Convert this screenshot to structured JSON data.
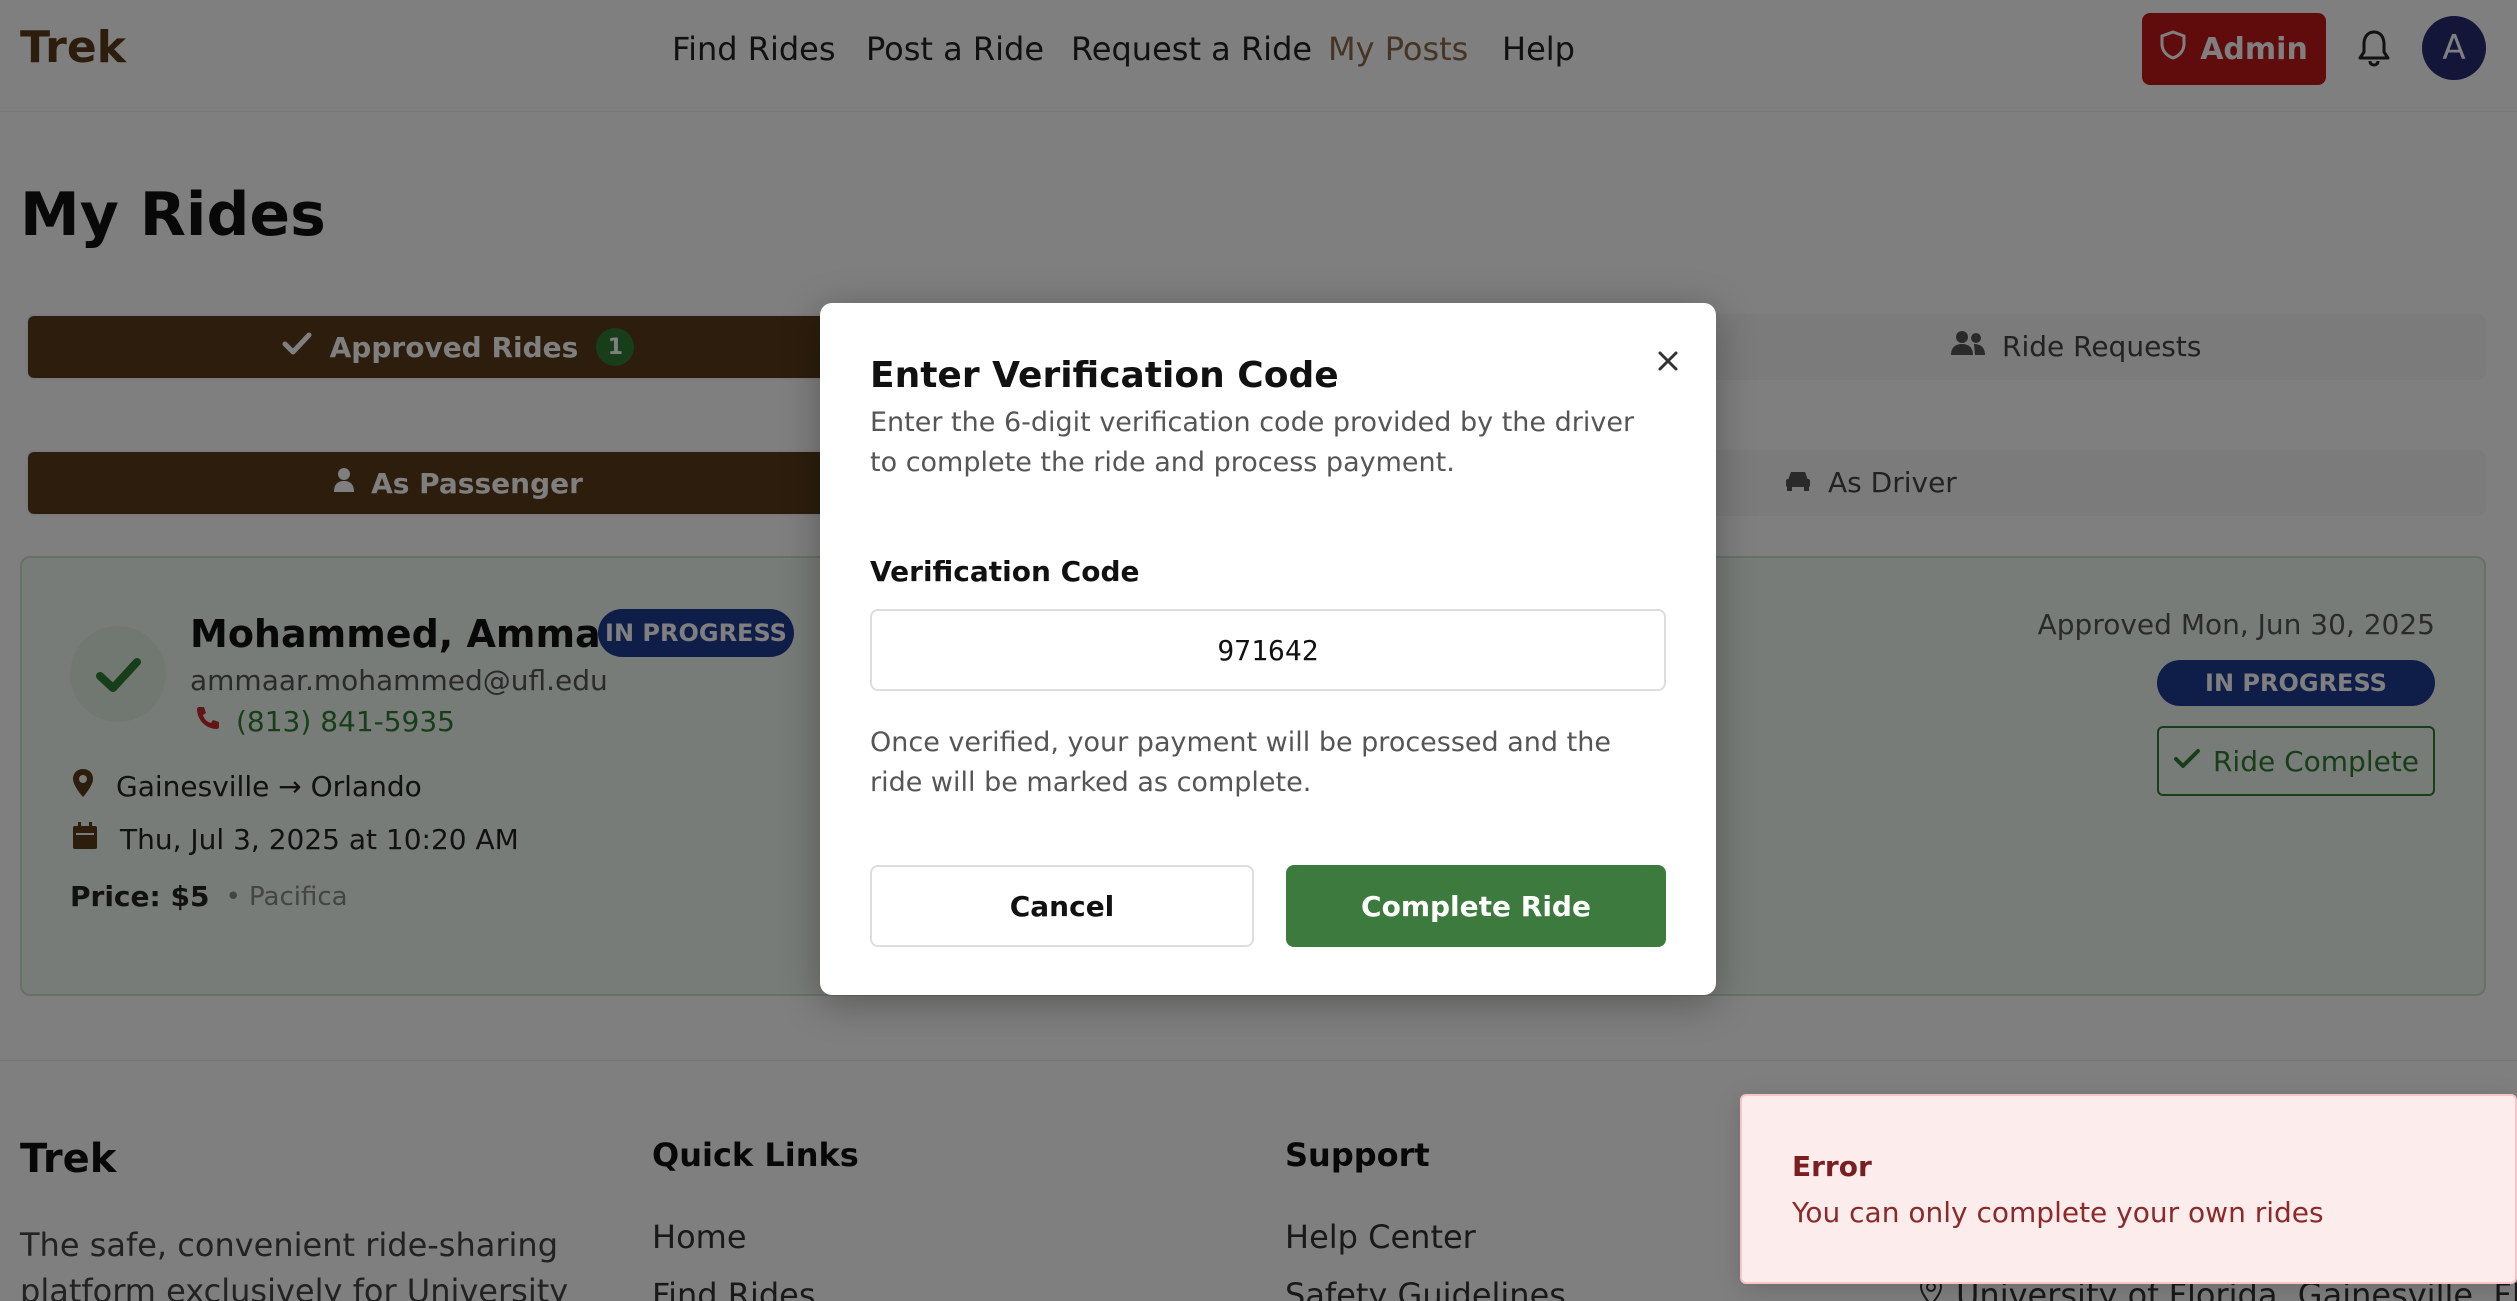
{
  "header": {
    "logo": "Trek",
    "nav": [
      "Find Rides",
      "Post a Ride",
      "Request a Ride",
      "My Posts",
      "Help"
    ],
    "active_nav": "My Posts",
    "admin_label": "Admin",
    "avatar_initial": "A",
    "icons": {
      "admin": "shield-icon",
      "notifications": "bell-icon"
    }
  },
  "page": {
    "title": "My Rides",
    "tabs": [
      {
        "label": "Approved Rides",
        "count": "1",
        "active": true,
        "icon": "check-icon"
      },
      {
        "label": "Ride Requests",
        "active": false,
        "icon": "users-icon"
      }
    ],
    "subtabs": [
      {
        "label": "As Passenger",
        "active": true,
        "icon": "user-icon"
      },
      {
        "label": "As Driver",
        "active": false,
        "icon": "car-icon"
      }
    ]
  },
  "ride": {
    "name": "Mohammed, Ammaar Y.",
    "status": "IN PROGRESS",
    "email": "ammaar.mohammed@ufl.edu",
    "phone": "(813) 841-5935",
    "route": "Gainesville → Orlando",
    "datetime": "Thu, Jul 3, 2025 at 10:20 AM",
    "price": "Price: $5",
    "vehicle": "• Pacifica",
    "approved": "Approved Mon, Jun 30, 2025",
    "complete_label": "Ride Complete"
  },
  "footer": {
    "brand": "Trek",
    "description": "The safe, convenient ride-sharing platform exclusively for University of",
    "quick_links_title": "Quick Links",
    "quick_links": [
      "Home",
      "Find Rides"
    ],
    "support_title": "Support",
    "support_links": [
      "Help Center",
      "Safety Guidelines"
    ],
    "address": "University of Florida, Gainesville, FL"
  },
  "modal": {
    "title": "Enter Verification Code",
    "description": "Enter the 6-digit verification code provided by the driver to complete the ride and process payment.",
    "field_label": "Verification Code",
    "code_value": "971642",
    "note": "Once verified, your payment will be processed and the ride will be marked as complete.",
    "cancel_label": "Cancel",
    "confirm_label": "Complete Ride"
  },
  "toast": {
    "title": "Error",
    "message": "You can only complete your own rides"
  },
  "colors": {
    "brand": "#5b3a1a",
    "admin": "#c0181b",
    "success": "#2e7d32",
    "status": "#1f3a93",
    "error_bg": "#fdecec"
  }
}
